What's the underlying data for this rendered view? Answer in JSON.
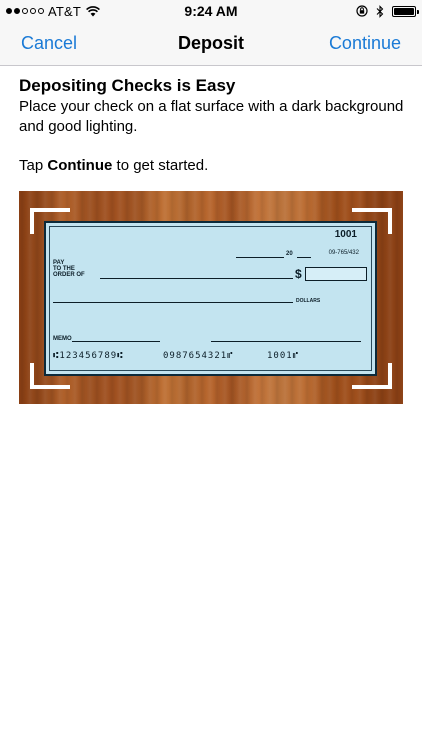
{
  "status_bar": {
    "carrier": "AT&T",
    "time": "9:24 AM",
    "signal_bars_filled": 2,
    "signal_bars_total": 5,
    "battery_level": 1.0
  },
  "nav": {
    "cancel_label": "Cancel",
    "title": "Deposit",
    "continue_label": "Continue"
  },
  "content": {
    "heading": "Depositing Checks is Easy",
    "body": "Place your check on a flat surface with a dark background and good lighting.",
    "tap_prefix": "Tap ",
    "tap_bold": "Continue",
    "tap_suffix": " to get started."
  },
  "check": {
    "number": "1001",
    "routing_fraction": "09-765/432",
    "year_suffix": "20",
    "pay_line1": "PAY",
    "pay_line2": "TO THE",
    "pay_line3": "ORDER OF",
    "dollar_sign": "$",
    "dollars_label": "DOLLARS",
    "memo_label": "MEMO",
    "micr_routing": "⑆123456789⑆",
    "micr_account": "0987654321⑈",
    "micr_check": "1001⑈"
  },
  "colors": {
    "accent": "#1a7ad6",
    "check_paper": "#c3e4f0",
    "wood": "#b2622b"
  }
}
